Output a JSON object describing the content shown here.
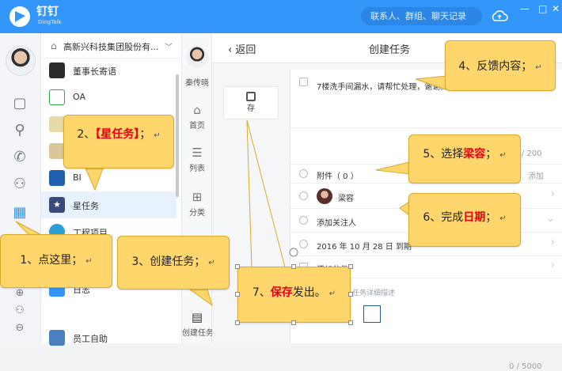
{
  "app": {
    "brand": "钉钉",
    "brand_sub": "DingTalk"
  },
  "search": {
    "placeholder": "联系人、群组、聊天记录"
  },
  "window_controls": {
    "minimize": "—",
    "maximize": "□",
    "close": "✕"
  },
  "org": {
    "name": "高新兴科技集团股份有...",
    "caret": "﹀"
  },
  "conversations": [
    {
      "label": "董事长寄语"
    },
    {
      "label": "OA"
    },
    {
      "label": ""
    },
    {
      "label": ""
    },
    {
      "label": "BI"
    },
    {
      "label": "星任务"
    },
    {
      "label": "工程项目"
    },
    {
      "label": "日志"
    },
    {
      "label": "员工自助"
    }
  ],
  "apps_panel": {
    "user_name": "秦传晓",
    "items": [
      {
        "label": "首页"
      },
      {
        "label": "列表"
      },
      {
        "label": "分类"
      },
      {
        "label": "创建任务"
      }
    ]
  },
  "task": {
    "back_label": "返回",
    "title": "创建任务",
    "save_label": "存",
    "content_text": "7楼洗手间漏水，请帮忙处理，谢谢。",
    "counter": "17 / 200",
    "attachment": "附件（ 0 ）",
    "add_label": "添加",
    "assignee": "梁容",
    "followers": "添加关注人",
    "due": "2016 年 10 月 28 日 到期",
    "category": "添加分类",
    "detail_placeholder": "在这里输入任务详细描述",
    "detail_counter": "0 / 5000"
  },
  "callouts": {
    "c1": {
      "prefix": "1、点这里；",
      "retmark": "↵"
    },
    "c2": {
      "prefix": "2、",
      "highlight": "【星任务】",
      "suffix": "；",
      "retmark": "↵"
    },
    "c3": {
      "prefix": "3、创建任务；",
      "retmark": "↵"
    },
    "c4": {
      "prefix": "4、反馈内容；",
      "retmark": "↵"
    },
    "c5": {
      "prefix": "5、选择",
      "highlight": "梁容",
      "suffix": "；",
      "retmark": "↵"
    },
    "c6": {
      "prefix": "6、完成",
      "highlight": "日期",
      "suffix": "；",
      "retmark": "↵"
    },
    "c7": {
      "prefix": "7、",
      "highlight": "保存",
      "suffix": "发出。",
      "retmark": "↵"
    }
  },
  "colors": {
    "brand_blue": "#3296fa",
    "callout": "#ffd66b",
    "highlight_red": "#e60012"
  }
}
